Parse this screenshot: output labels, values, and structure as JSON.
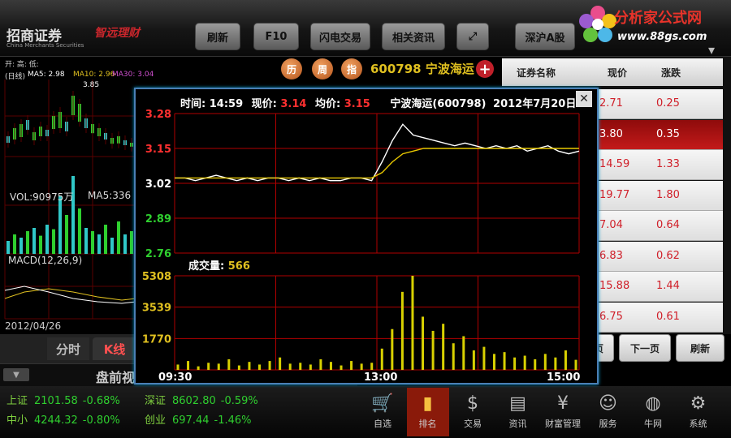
{
  "app": {
    "logo_name": "招商证券",
    "logo_sub": "China Merchants Securities",
    "logo_slogan": "智远理财",
    "watermark_title": "分析家公式网",
    "watermark_url": "www.88gs.com"
  },
  "toolbar": {
    "refresh": "刷新",
    "f10": "F10",
    "flash_trade": "闪电交易",
    "related_news": "相关资讯",
    "market_select": "深沪A股"
  },
  "stock_header": {
    "chip_history": "历",
    "chip_week": "周",
    "chip_index": "指",
    "code_name": "600798 宁波海运"
  },
  "left_chart": {
    "summary_labels": "开:  高:  低:",
    "ma_label_day": "(日线)",
    "ma5": "MA5: 2.98",
    "ma10": "MA10: 2.96",
    "ma30": "MA30: 3.04",
    "high_marker": "3.85",
    "vol_label": "VOL:90975万",
    "vol_ma5": "MA5:336",
    "macd_label": "MACD(12,26,9)",
    "date": "2012/04/26"
  },
  "left_tabs": {
    "intraday": "分时",
    "kline": "K线"
  },
  "premarket_label": "盘前视",
  "stock_list": {
    "columns": [
      "证券名称",
      "现价",
      "涨跌"
    ],
    "rows": [
      {
        "price": "2.71",
        "change": "0.25"
      },
      {
        "price": "3.80",
        "change": "0.35"
      },
      {
        "price": "14.59",
        "change": "1.33"
      },
      {
        "price": "19.77",
        "change": "1.80"
      },
      {
        "price": "7.04",
        "change": "0.64"
      },
      {
        "price": "6.83",
        "change": "0.62"
      },
      {
        "price": "15.88",
        "change": "1.44"
      },
      {
        "price": "6.75",
        "change": "0.61"
      }
    ],
    "selected_index": 1,
    "prev_partial": "页",
    "next_page": "下一页",
    "refresh": "刷新"
  },
  "markets": [
    {
      "name": "上证",
      "value": "2101.58",
      "change": "-0.68%"
    },
    {
      "name": "深证",
      "value": "8602.80",
      "change": "-0.59%"
    },
    {
      "name": "中小",
      "value": "4244.32",
      "change": "-0.80%"
    },
    {
      "name": "创业",
      "value": "697.44",
      "change": "-1.46%"
    }
  ],
  "bottom_nav": [
    {
      "label": "自选",
      "icon": "cart-icon"
    },
    {
      "label": "排名",
      "icon": "bar-chart-icon"
    },
    {
      "label": "交易",
      "icon": "dollar-icon"
    },
    {
      "label": "资讯",
      "icon": "document-icon"
    },
    {
      "label": "财富管理",
      "icon": "yen-icon"
    },
    {
      "label": "服务",
      "icon": "person-icon"
    },
    {
      "label": "牛网",
      "icon": "globe-icon"
    },
    {
      "label": "系统",
      "icon": "gear-icon"
    }
  ],
  "popup": {
    "time_label": "时间:",
    "time_value": "14:59",
    "price_label": "现价:",
    "price_value": "3.14",
    "avg_label": "均价:",
    "avg_value": "3.15",
    "stock": "宁波海运(600798)",
    "date": "2012年7月20日",
    "volume_label": "成交量:",
    "volume_value": "566",
    "price_ticks": [
      "3.28",
      "3.15",
      "3.02",
      "2.89",
      "2.76"
    ],
    "volume_ticks": [
      "5308",
      "3539",
      "1770"
    ],
    "time_ticks": [
      "09:30",
      "13:00",
      "15:00"
    ]
  },
  "colors": {
    "up": "#ff3030",
    "down": "#2fcf2f",
    "price_line": "#ffffff",
    "avg_line": "#e8c800",
    "grid": "#b00000",
    "popup_border": "#4a7fb5"
  },
  "chart_data": {
    "type": "line",
    "x_labels": [
      "09:30",
      "13:00",
      "15:00"
    ],
    "ylim": [
      2.76,
      3.28
    ],
    "series": [
      {
        "name": "现价",
        "values": [
          3.04,
          3.04,
          3.03,
          3.04,
          3.05,
          3.04,
          3.03,
          3.04,
          3.03,
          3.04,
          3.04,
          3.03,
          3.04,
          3.03,
          3.04,
          3.03,
          3.03,
          3.04,
          3.04,
          3.03,
          3.1,
          3.18,
          3.24,
          3.2,
          3.19,
          3.18,
          3.17,
          3.16,
          3.17,
          3.16,
          3.15,
          3.16,
          3.15,
          3.16,
          3.14,
          3.15,
          3.16,
          3.14,
          3.13,
          3.14
        ]
      },
      {
        "name": "均价",
        "values": [
          3.04,
          3.04,
          3.04,
          3.04,
          3.04,
          3.04,
          3.04,
          3.04,
          3.04,
          3.04,
          3.04,
          3.04,
          3.04,
          3.04,
          3.04,
          3.04,
          3.04,
          3.04,
          3.04,
          3.04,
          3.06,
          3.1,
          3.13,
          3.14,
          3.15,
          3.15,
          3.15,
          3.15,
          3.15,
          3.15,
          3.15,
          3.15,
          3.15,
          3.15,
          3.15,
          3.15,
          3.15,
          3.15,
          3.15,
          3.15
        ]
      }
    ],
    "volume": {
      "ylim": [
        0,
        5308
      ],
      "values": [
        300,
        500,
        200,
        400,
        350,
        600,
        250,
        450,
        300,
        500,
        700,
        350,
        400,
        300,
        600,
        450,
        250,
        500,
        350,
        400,
        1200,
        2300,
        4400,
        5308,
        3000,
        2200,
        2600,
        1500,
        1900,
        1100,
        1300,
        900,
        1000,
        700,
        800,
        600,
        900,
        700,
        1100,
        566
      ]
    }
  }
}
